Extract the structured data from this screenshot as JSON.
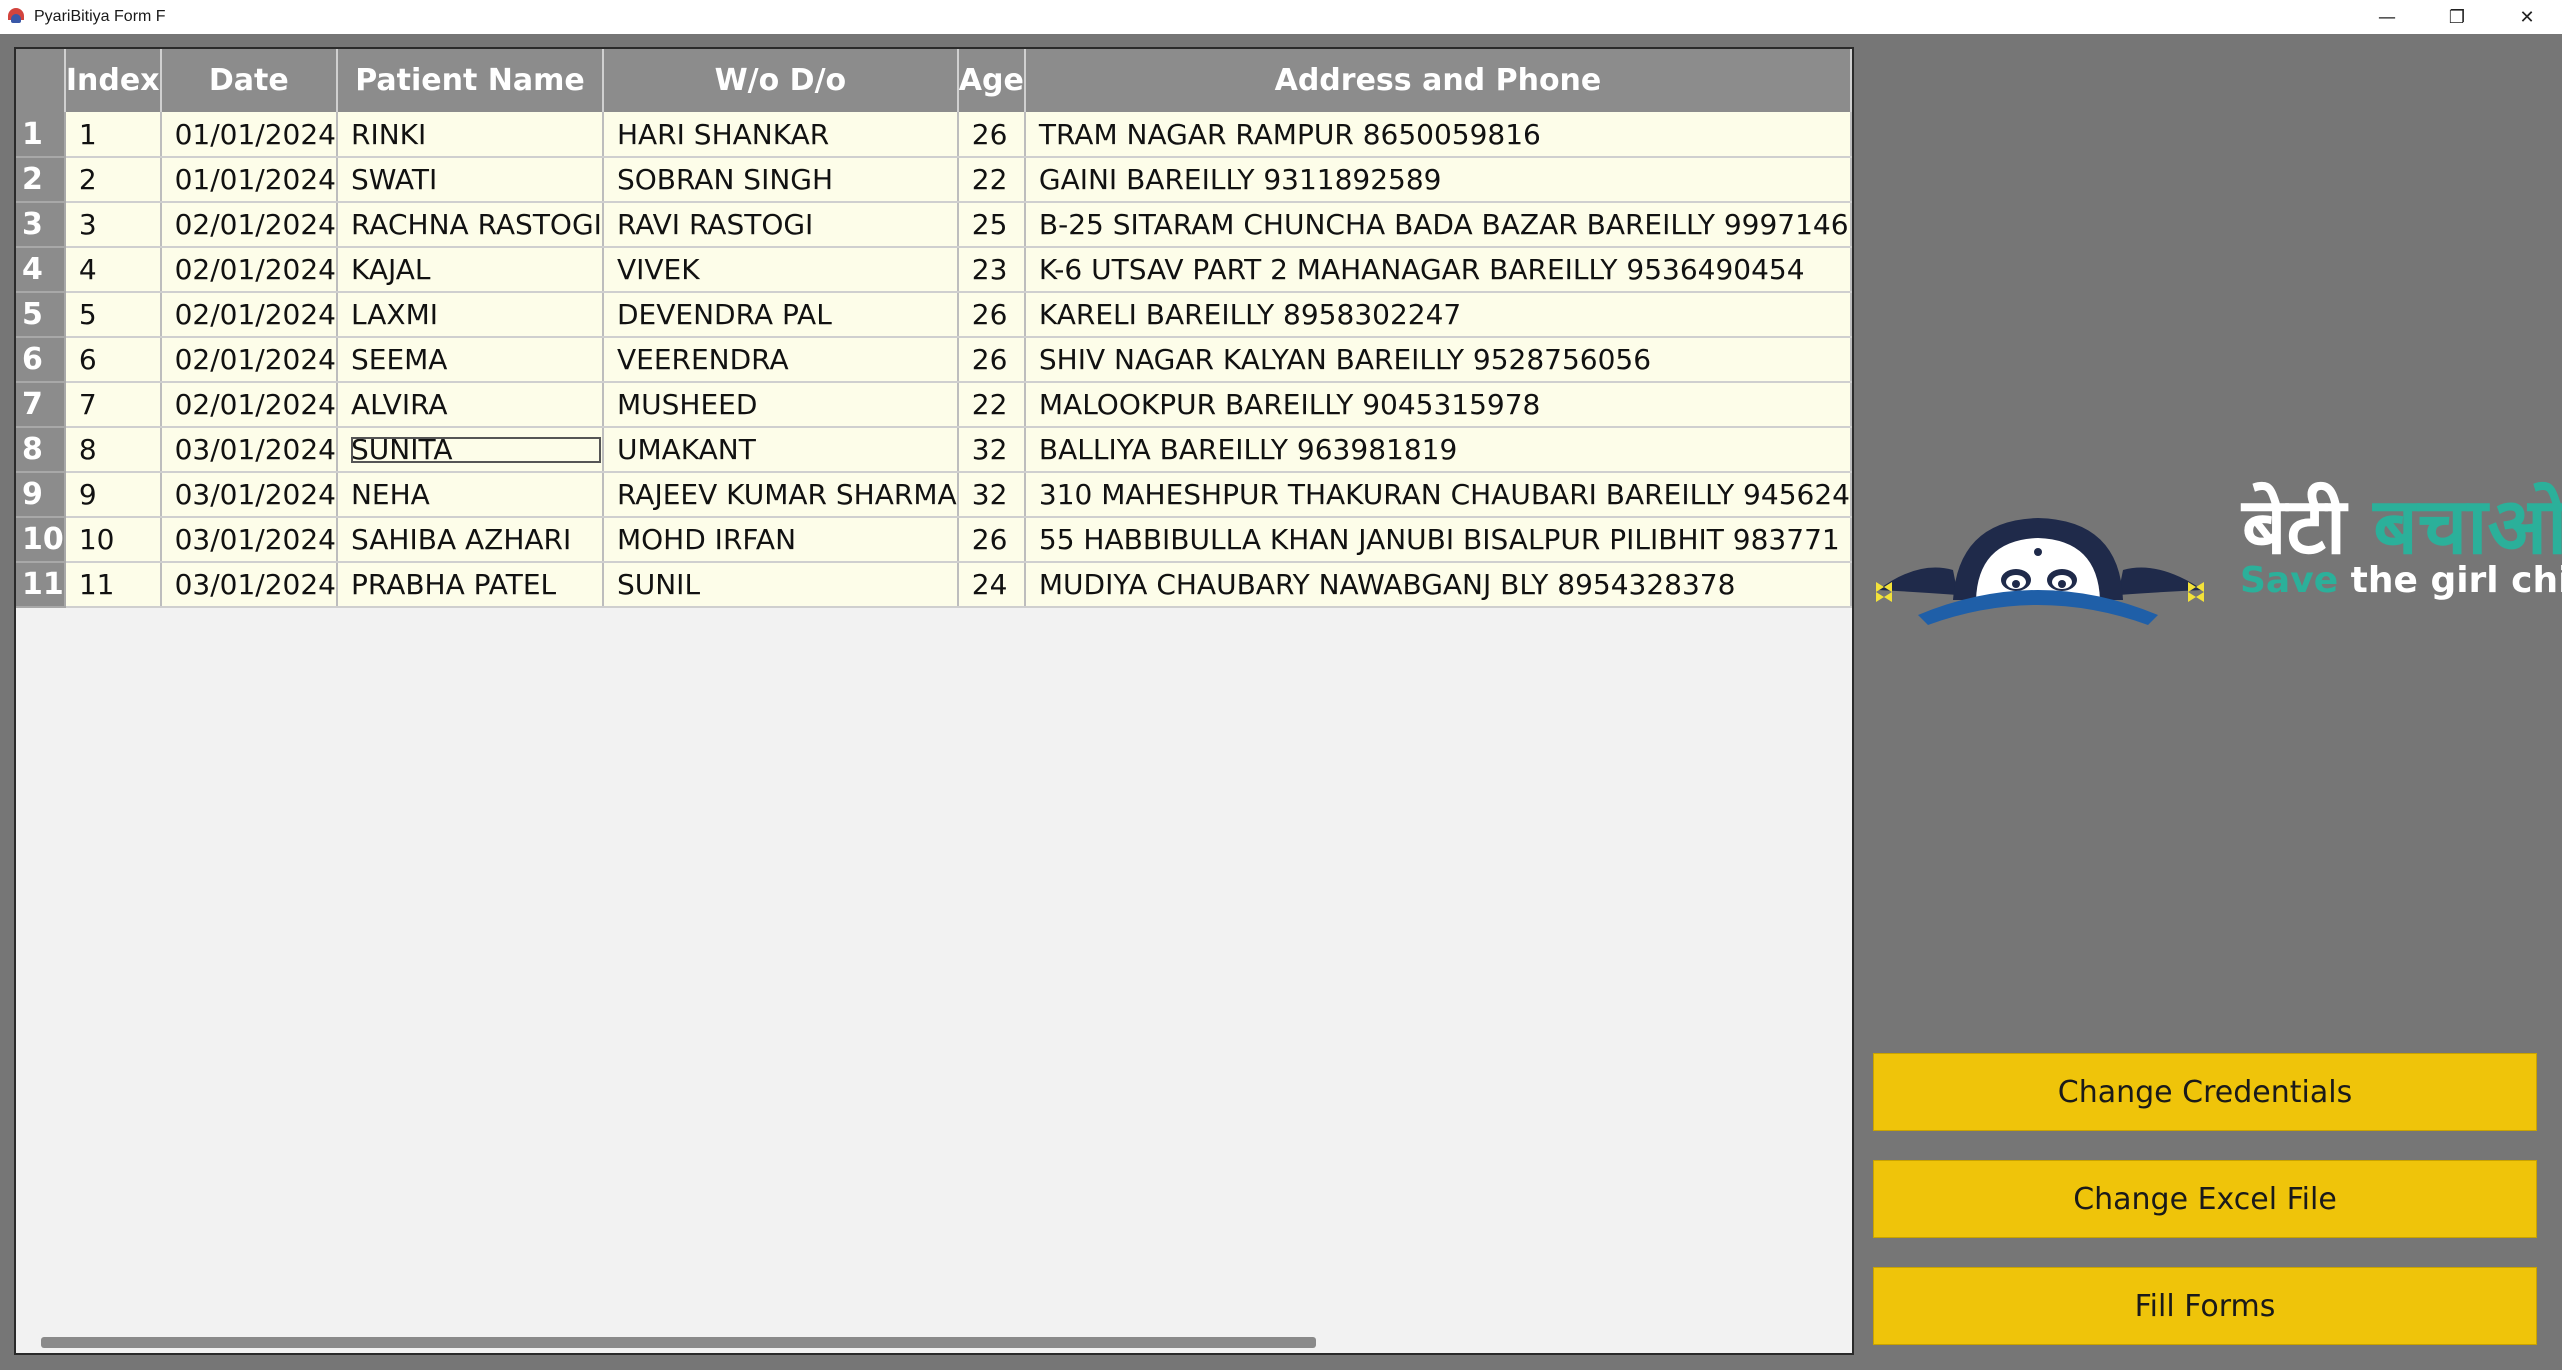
{
  "window": {
    "title": "PyariBitiya Form F",
    "minimize": "—",
    "restore": "❐",
    "close": "✕"
  },
  "table": {
    "columns": [
      "Index",
      "Date",
      "Patient Name",
      "W/o D/o",
      "Age",
      "Address and Phone"
    ],
    "rows": [
      {
        "n": "1",
        "index": "1",
        "date": "01/01/2024",
        "name": "RINKI",
        "wodo": "HARI SHANKAR",
        "age": "26",
        "address": "TRAM NAGAR RAMPUR 8650059816"
      },
      {
        "n": "2",
        "index": "2",
        "date": "01/01/2024",
        "name": "SWATI",
        "wodo": "SOBRAN SINGH",
        "age": "22",
        "address": "GAINI BAREILLY 9311892589"
      },
      {
        "n": "3",
        "index": "3",
        "date": "02/01/2024",
        "name": "RACHNA RASTOGI",
        "wodo": "RAVI RASTOGI",
        "age": "25",
        "address": "B-25 SITARAM CHUNCHA BADA BAZAR BAREILLY 9997146"
      },
      {
        "n": "4",
        "index": "4",
        "date": "02/01/2024",
        "name": "KAJAL",
        "wodo": "VIVEK",
        "age": "23",
        "address": "K-6 UTSAV PART 2 MAHANAGAR BAREILLY 9536490454"
      },
      {
        "n": "5",
        "index": "5",
        "date": "02/01/2024",
        "name": "LAXMI",
        "wodo": "DEVENDRA PAL",
        "age": "26",
        "address": "KARELI BAREILLY 8958302247"
      },
      {
        "n": "6",
        "index": "6",
        "date": "02/01/2024",
        "name": "SEEMA",
        "wodo": "VEERENDRA",
        "age": "26",
        "address": "SHIV NAGAR KALYAN BAREILLY 9528756056"
      },
      {
        "n": "7",
        "index": "7",
        "date": "02/01/2024",
        "name": "ALVIRA",
        "wodo": "MUSHEED",
        "age": "22",
        "address": "MALOOKPUR BAREILLY 9045315978"
      },
      {
        "n": "8",
        "index": "8",
        "date": "03/01/2024",
        "name": "SUNITA",
        "wodo": "UMAKANT",
        "age": "32",
        "address": "BALLIYA BAREILLY 963981819"
      },
      {
        "n": "9",
        "index": "9",
        "date": "03/01/2024",
        "name": "NEHA",
        "wodo": "RAJEEV KUMAR SHARMA",
        "age": "32",
        "address": "310 MAHESHPUR THAKURAN CHAUBARI BAREILLY 945624"
      },
      {
        "n": "10",
        "index": "10",
        "date": "03/01/2024",
        "name": "SAHIBA AZHARI",
        "wodo": "MOHD IRFAN",
        "age": "26",
        "address": "55 HABBIBULLA KHAN JANUBI BISALPUR PILIBHIT 983771"
      },
      {
        "n": "11",
        "index": "11",
        "date": "03/01/2024",
        "name": "PRABHA PATEL",
        "wodo": "SUNIL",
        "age": "24",
        "address": "MUDIYA CHAUBARY NAWABGANJ BLY 8954328378"
      }
    ]
  },
  "logo": {
    "hindi_part1": "बेटी",
    "hindi_part2": "बचाओ",
    "english_part1": "Save",
    "english_part2": "the girl child"
  },
  "buttons": {
    "change_credentials": "Change Credentials",
    "change_excel": "Change Excel File",
    "fill_forms": "Fill Forms"
  },
  "colors": {
    "background": "#767676",
    "header": "#8c8c8c",
    "cell": "#fdfde9",
    "button": "#efc40a",
    "logo_accent": "#2bb09a"
  }
}
